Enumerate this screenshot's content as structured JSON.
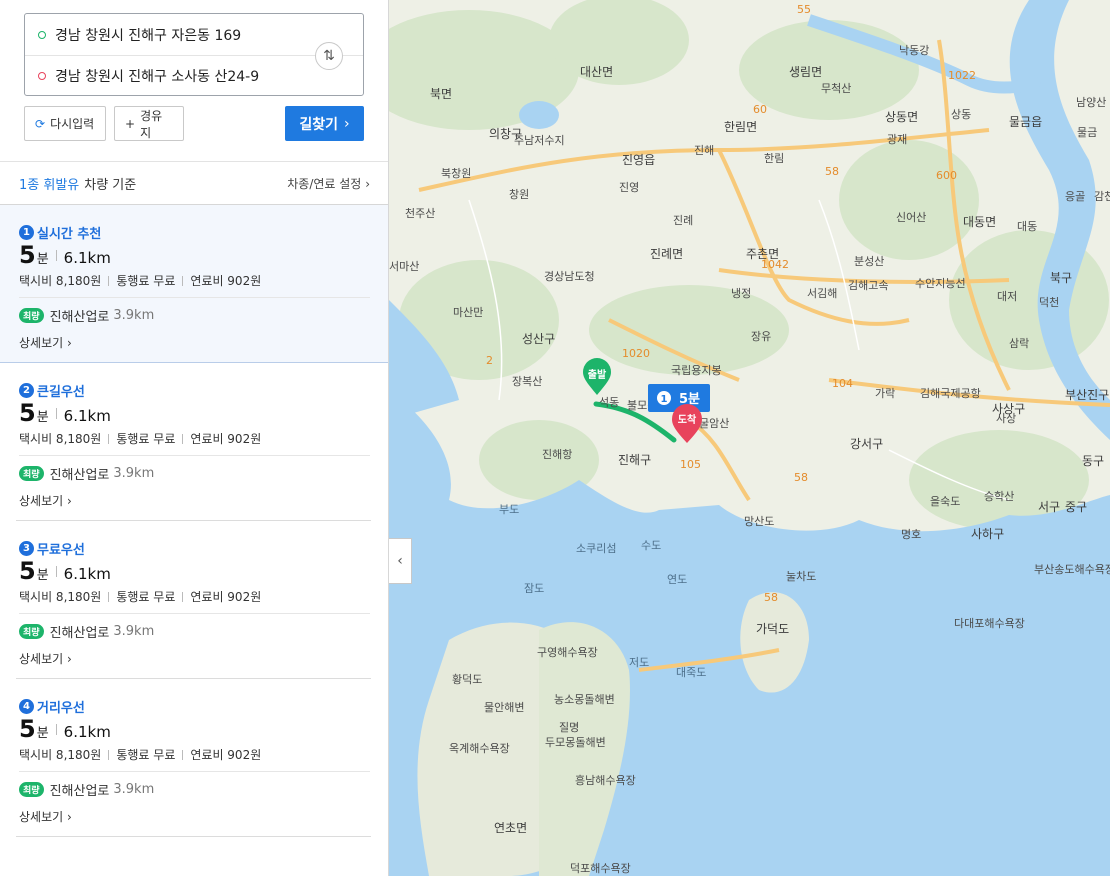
{
  "search": {
    "start": "경남 창원시 진해구 자은동 169",
    "end": "경남 창원시 진해구 소사동 산24-9",
    "swap_icon": "⇅"
  },
  "buttons": {
    "reset": "다시입력",
    "via": "경유지",
    "go": "길찾기"
  },
  "vehicle": {
    "fuel": "1종 휘발유",
    "basis": "차량 기준",
    "setting": "차종/연료 설정"
  },
  "routes": [
    {
      "num": "1",
      "name": "실시간 추천",
      "time": "5",
      "time_unit": "분",
      "distance": "6.1km",
      "taxi": "택시비 8,180원",
      "toll": "통행료 무료",
      "fuel": "연료비 902원",
      "badge": "최량",
      "via": "진해산업로",
      "via_dist": "3.9km",
      "detail": "상세보기"
    },
    {
      "num": "2",
      "name": "큰길우선",
      "time": "5",
      "time_unit": "분",
      "distance": "6.1km",
      "taxi": "택시비 8,180원",
      "toll": "통행료 무료",
      "fuel": "연료비 902원",
      "badge": "최량",
      "via": "진해산업로",
      "via_dist": "3.9km",
      "detail": "상세보기"
    },
    {
      "num": "3",
      "name": "무료우선",
      "time": "5",
      "time_unit": "분",
      "distance": "6.1km",
      "taxi": "택시비 8,180원",
      "toll": "통행료 무료",
      "fuel": "연료비 902원",
      "badge": "최량",
      "via": "진해산업로",
      "via_dist": "3.9km",
      "detail": "상세보기"
    },
    {
      "num": "4",
      "name": "거리우선",
      "time": "5",
      "time_unit": "분",
      "distance": "6.1km",
      "taxi": "택시비 8,180원",
      "toll": "통행료 무료",
      "fuel": "연료비 902원",
      "badge": "최량",
      "via": "진해산업로",
      "via_dist": "3.9km",
      "detail": "상세보기"
    }
  ],
  "map": {
    "start_label": "출발",
    "end_label": "도착",
    "route_badge_num": "1",
    "route_badge_time": "5분",
    "place_labels": [
      "대산면",
      "북면",
      "의창구",
      "주남저수지",
      "진영읍",
      "한림면",
      "생림면",
      "무척산",
      "상동면",
      "물금읍",
      "낙동강",
      "진례면",
      "주촌면",
      "신어산",
      "대동면",
      "분성산",
      "김해고속",
      "수안지능선",
      "북구",
      "천주산",
      "경상남도청",
      "마산만",
      "성산구",
      "장복산",
      "국립용지봉",
      "불모산",
      "굴암산",
      "진해항",
      "진해구",
      "김해국제공항",
      "사상구",
      "부산진구",
      "강서구",
      "승학산",
      "을숙도",
      "사하구",
      "서구",
      "중구",
      "동구",
      "부도",
      "소쿠리섬",
      "수도",
      "연도",
      "망산도",
      "눌차도",
      "가덕도",
      "잠도",
      "구영해수욕장",
      "저도",
      "대죽도",
      "황덕도",
      "물안해변",
      "농소몽돌해변",
      "질명",
      "두모몽돌해변",
      "옥계해수욕장",
      "흥남해수욕장",
      "연초면",
      "덕포해수욕장",
      "다대포해수욕장",
      "부산송도해수욕장",
      "서마산",
      "북창원",
      "창원",
      "진영",
      "진례",
      "냉정",
      "서김해",
      "장유",
      "가락",
      "대저",
      "덕천",
      "삼락",
      "사상",
      "명호",
      "대동",
      "남양산",
      "물금",
      "상동",
      "광재",
      "한림",
      "진해",
      "응골",
      "감천동",
      "석동"
    ],
    "road_numbers": [
      "55",
      "1022",
      "60",
      "58",
      "600",
      "1042",
      "1020",
      "104",
      "105",
      "58",
      "58",
      "2"
    ]
  },
  "icons": {
    "collapse": "‹"
  }
}
